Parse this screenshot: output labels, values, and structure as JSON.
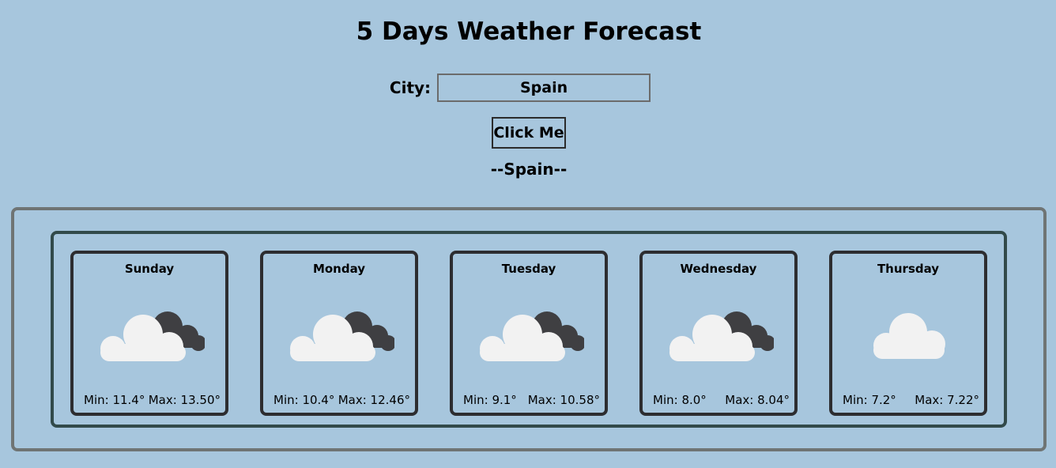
{
  "page": {
    "title": "5 Days Weather Forecast"
  },
  "form": {
    "city_label": "City:",
    "city_value": "Spain",
    "button_label": "Click Me"
  },
  "result": {
    "city_heading": "--Spain--"
  },
  "forecast": [
    {
      "day": "Sunday",
      "min": "Min: 11.4°",
      "max": "Max: 13.50°",
      "icon": "partly-cloudy-icon"
    },
    {
      "day": "Monday",
      "min": "Min: 10.4°",
      "max": "Max: 12.46°",
      "icon": "partly-cloudy-icon"
    },
    {
      "day": "Tuesday",
      "min": "Min: 9.1°",
      "max": "Max: 10.58°",
      "icon": "partly-cloudy-icon"
    },
    {
      "day": "Wednesday",
      "min": "Min: 8.0°",
      "max": "Max: 8.04°",
      "icon": "partly-cloudy-icon"
    },
    {
      "day": "Thursday",
      "min": "Min: 7.2°",
      "max": "Max: 7.22°",
      "icon": "cloud-icon"
    }
  ],
  "colors": {
    "background": "#a7c6dd",
    "card_border": "#2d2d30",
    "inner_panel_border": "#324a4a",
    "outer_panel_border": "#6f7474",
    "cloud_light": "#f2f2f2",
    "cloud_dark": "#3f3f42"
  }
}
